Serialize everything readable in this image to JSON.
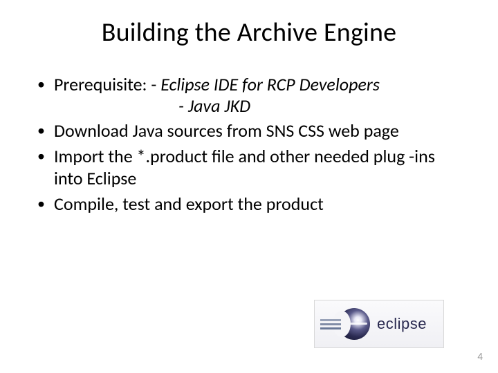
{
  "title": "Building the Archive Engine",
  "bullets": {
    "b1_label": "Prerequisite: - ",
    "b1_item1": "Eclipse IDE for RCP Developers",
    "b1_item2": "- Java JKD",
    "b2": "Download Java sources from SNS CSS web page",
    "b3": "Import the *.product file and other needed plug -ins into Eclipse",
    "b4": "Compile, test and export the product"
  },
  "logo": {
    "name": "eclipse"
  },
  "page_number": "4"
}
